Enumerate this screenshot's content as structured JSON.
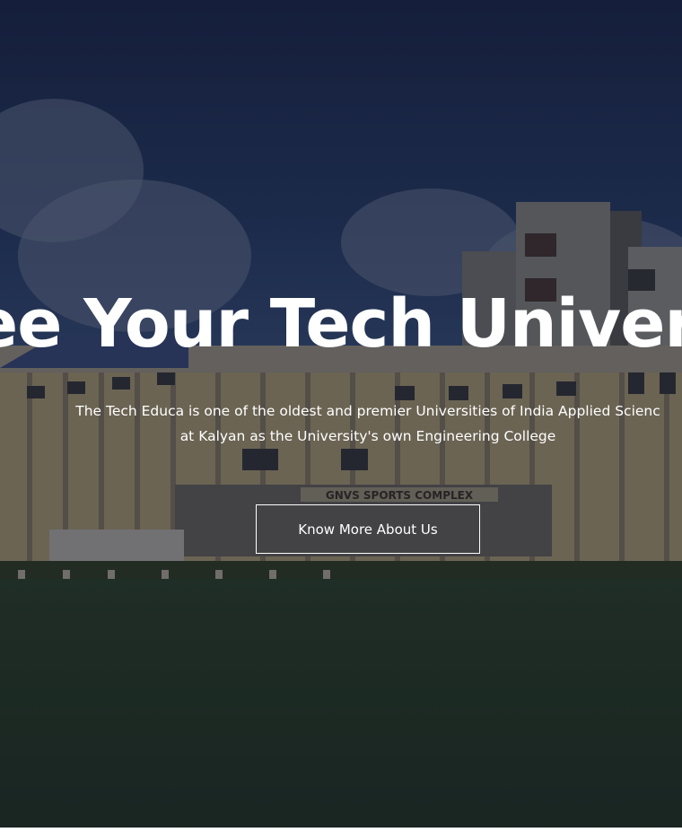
{
  "hero": {
    "title": "ee Your Tech Univers",
    "description_line1": "The Tech Educa is one of the oldest and premier Universities of India Applied Scienc",
    "description_line2": "at Kalyan as the University's own Engineering College",
    "cta_label": "Know More About Us"
  },
  "background": {
    "sign_text": "GNVS SPORTS COMPLEX",
    "overlay_color": "#0e1226",
    "text_color": "#ffffff"
  }
}
